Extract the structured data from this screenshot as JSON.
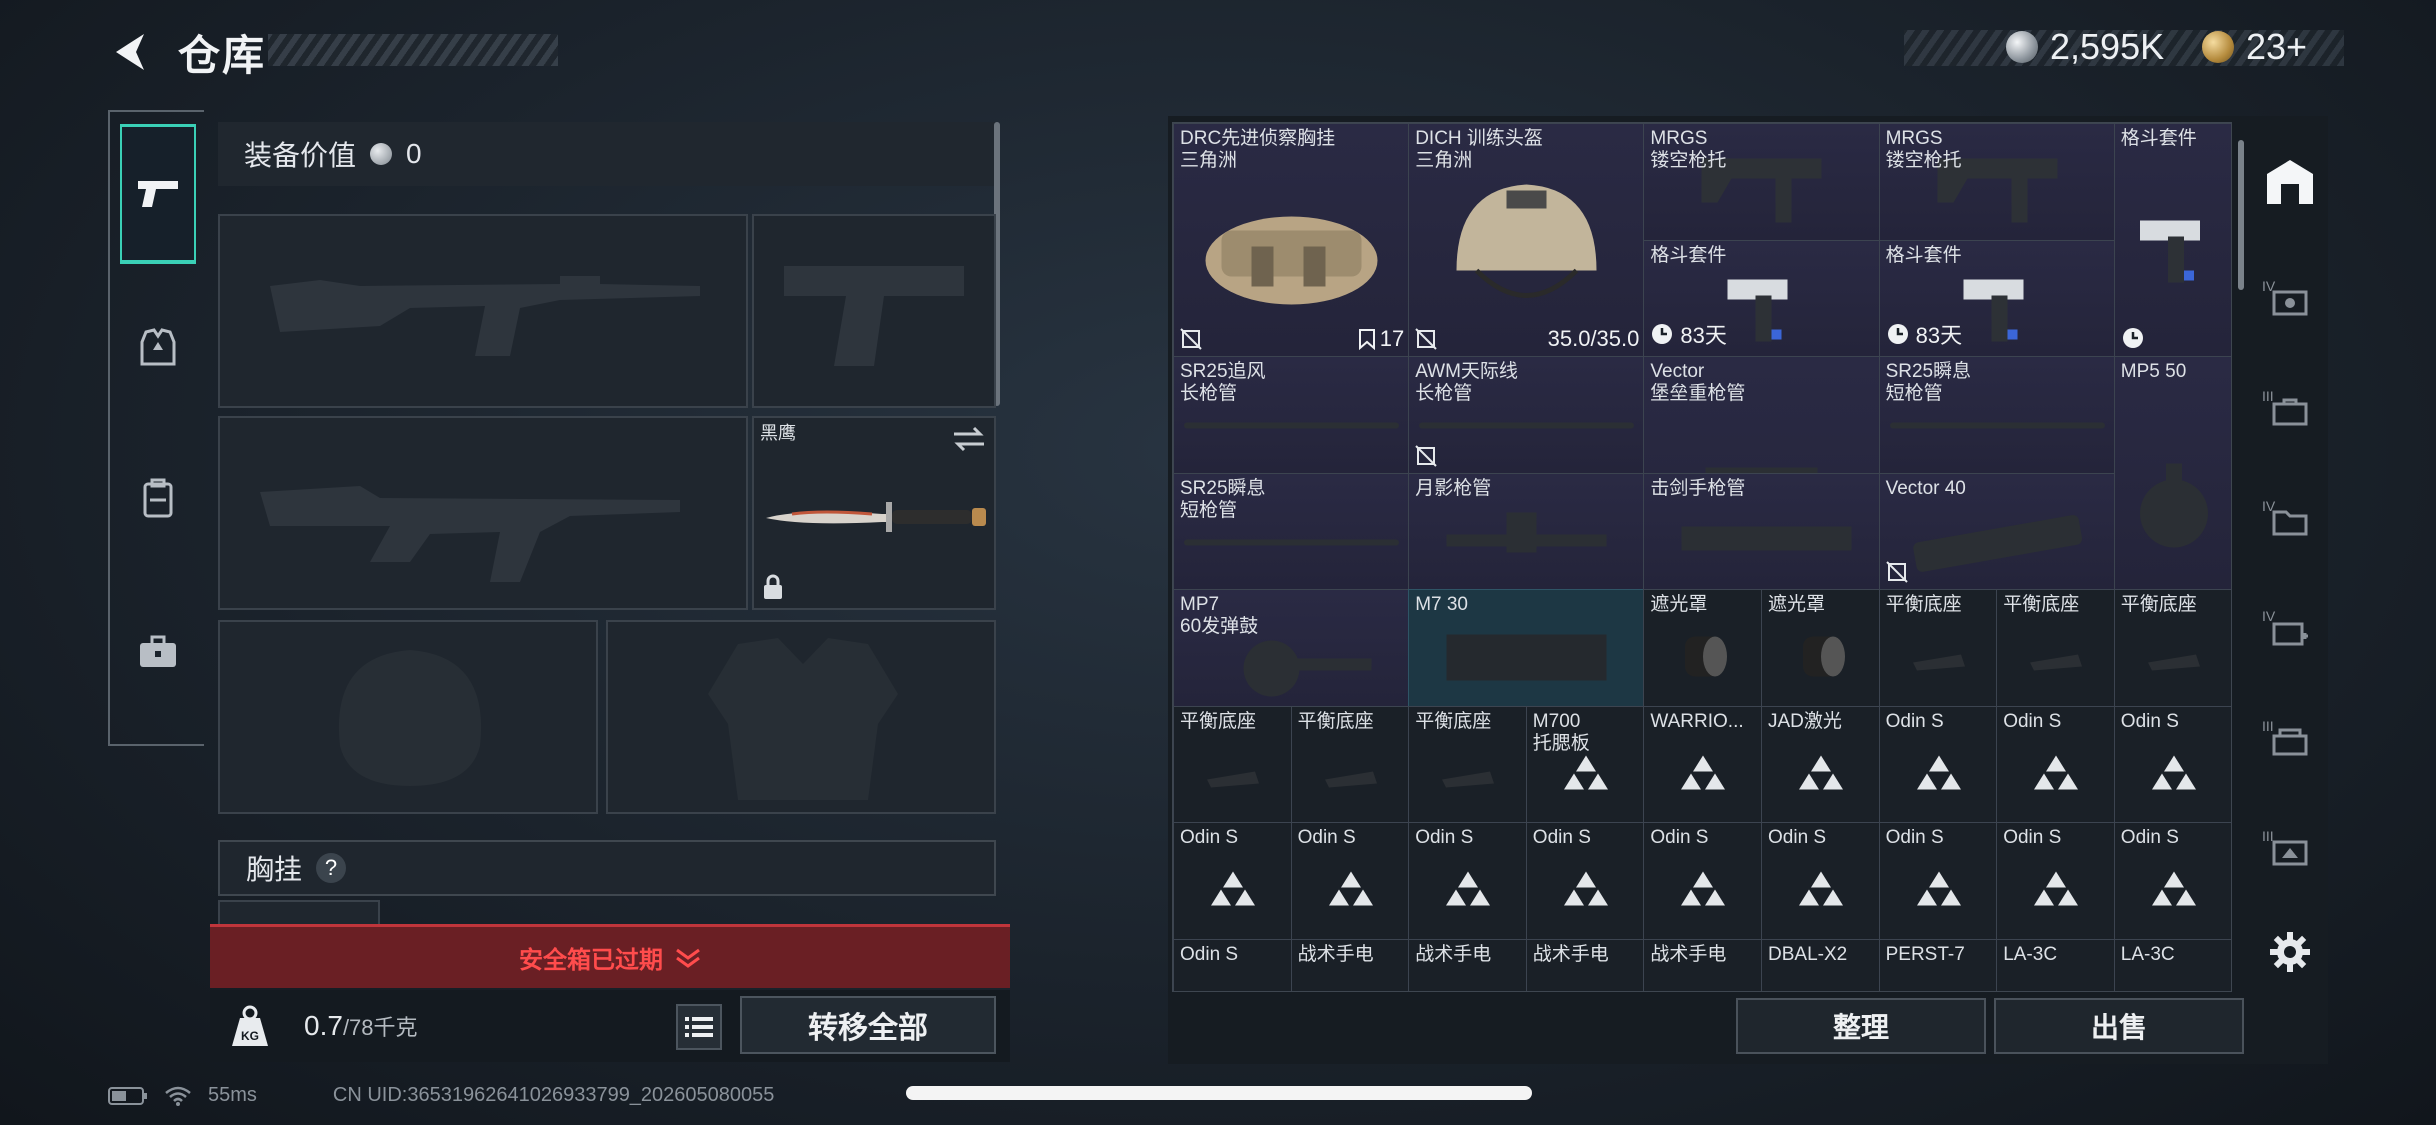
{
  "header": {
    "title": "仓库",
    "silver": "2,595K",
    "gold": "23+"
  },
  "loadout": {
    "value_label": "装备价值",
    "value": "0",
    "melee_name": "黑鹰",
    "chest_label": "胸挂",
    "help": "?",
    "safebox_expired": "安全箱已过期",
    "weight_value": "0.7",
    "weight_cap": "/78千克",
    "transfer_all": "转移全部"
  },
  "stash": {
    "cells": [
      {
        "n": "DRC先进侦察胸挂\n三角洲",
        "l": "",
        "r": "17"
      },
      {
        "n": "DICH 训练头盔\n三角洲",
        "l": "",
        "r": "35.0/35.0"
      },
      {
        "n": "MRGS\n镂空枪托",
        "l": "",
        "r": ""
      },
      {
        "n": "MRGS\n镂空枪托",
        "l": "",
        "r": ""
      },
      {
        "n": "格斗套件",
        "l": "",
        "r": ""
      },
      {
        "n": "格斗套件",
        "l": "83天",
        "r": ""
      },
      {
        "n": "格斗套件",
        "l": "83天",
        "r": ""
      },
      {
        "n": "SR25追风\n长枪管",
        "l": "",
        "r": ""
      },
      {
        "n": "AWM天际线\n长枪管",
        "l": "",
        "r": ""
      },
      {
        "n": "Vector\n堡垒重枪管",
        "l": "",
        "r": ""
      },
      {
        "n": "SR25瞬息\n短枪管",
        "l": "",
        "r": ""
      },
      {
        "n": "MP5 50",
        "l": "",
        "r": ""
      },
      {
        "n": "SR25瞬息\n短枪管",
        "l": "",
        "r": ""
      },
      {
        "n": "月影枪管",
        "l": "",
        "r": ""
      },
      {
        "n": "击剑手枪管",
        "l": "",
        "r": ""
      },
      {
        "n": "Vector 40",
        "l": "",
        "r": ""
      },
      {
        "n": "MP7\n60发弹鼓",
        "l": "",
        "r": ""
      },
      {
        "n": "M7 30",
        "l": "",
        "r": ""
      },
      {
        "n": "遮光罩",
        "l": "",
        "r": ""
      },
      {
        "n": "遮光罩",
        "l": "",
        "r": ""
      },
      {
        "n": "平衡底座",
        "l": "",
        "r": ""
      },
      {
        "n": "平衡底座",
        "l": "",
        "r": ""
      },
      {
        "n": "平衡底座",
        "l": "",
        "r": ""
      },
      {
        "n": "平衡底座",
        "l": "",
        "r": ""
      },
      {
        "n": "平衡底座",
        "l": "",
        "r": ""
      },
      {
        "n": "平衡底座",
        "l": "",
        "r": ""
      },
      {
        "n": "M700\n托腮板",
        "l": "",
        "r": ""
      },
      {
        "n": "WARRIO...",
        "l": "",
        "r": ""
      },
      {
        "n": "JAD激光",
        "l": "",
        "r": ""
      },
      {
        "n": "Odin S",
        "l": "",
        "r": ""
      },
      {
        "n": "Odin S",
        "l": "",
        "r": ""
      },
      {
        "n": "Odin S",
        "l": "",
        "r": ""
      },
      {
        "n": "Odin S",
        "l": "",
        "r": ""
      },
      {
        "n": "Odin S",
        "l": "",
        "r": ""
      },
      {
        "n": "Odin S",
        "l": "",
        "r": ""
      },
      {
        "n": "Odin S",
        "l": "",
        "r": ""
      },
      {
        "n": "Odin S",
        "l": "",
        "r": ""
      },
      {
        "n": "Odin S",
        "l": "",
        "r": ""
      },
      {
        "n": "Odin S",
        "l": "",
        "r": ""
      },
      {
        "n": "Odin S",
        "l": "",
        "r": ""
      },
      {
        "n": "Odin S",
        "l": "",
        "r": ""
      },
      {
        "n": "Odin S",
        "l": "",
        "r": ""
      },
      {
        "n": "战术手电",
        "l": "",
        "r": ""
      },
      {
        "n": "战术手电",
        "l": "",
        "r": ""
      },
      {
        "n": "战术手电",
        "l": "",
        "r": ""
      },
      {
        "n": "战术手电",
        "l": "",
        "r": ""
      },
      {
        "n": "DBAL-X2",
        "l": "",
        "r": ""
      },
      {
        "n": "PERST-7",
        "l": "",
        "r": ""
      },
      {
        "n": "LA-3C",
        "l": "",
        "r": ""
      },
      {
        "n": "LA-3C",
        "l": "",
        "r": ""
      }
    ],
    "sort": "整理",
    "sell": "出售"
  },
  "right_rail": {
    "tiers": [
      "IV",
      "III",
      "IV",
      "IV",
      "III",
      "III"
    ]
  },
  "status": {
    "ping": "55ms",
    "uid": "CN UID:3653196264102693379​9_202605080055"
  }
}
